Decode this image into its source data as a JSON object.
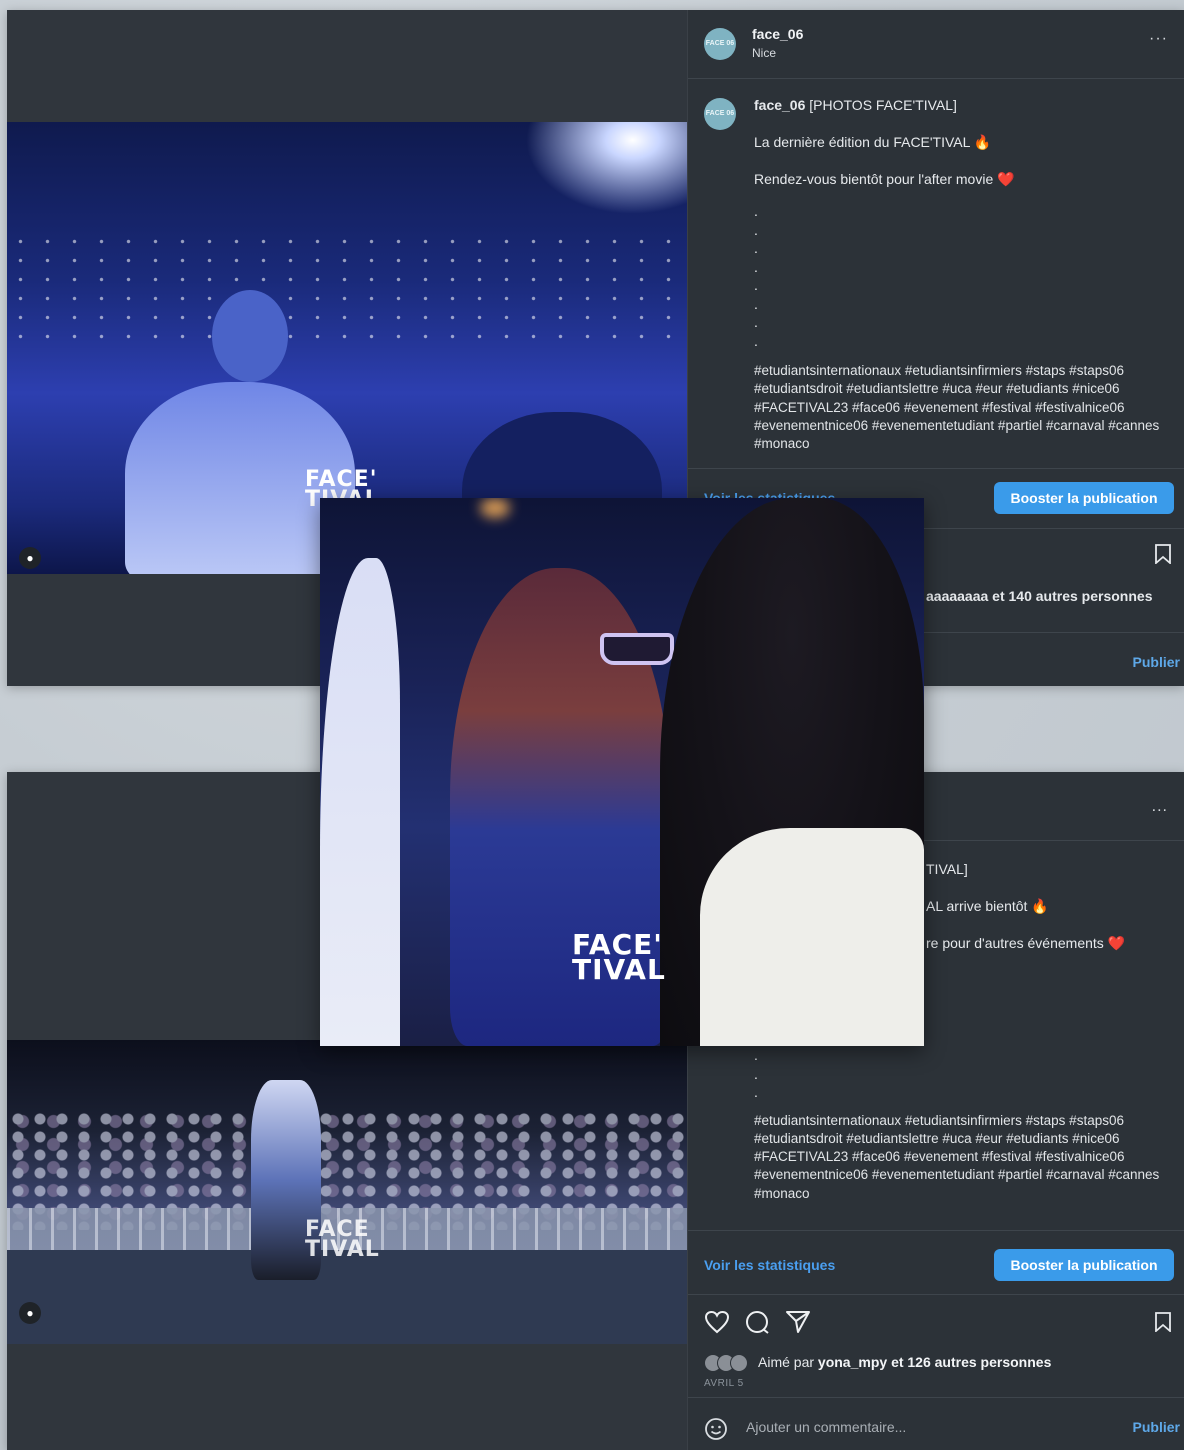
{
  "accent": "#3a9bea",
  "post1": {
    "account": {
      "avatar_text": "FACE 06",
      "username": "face_06",
      "location": "Nice"
    },
    "caption": {
      "username": "face_06",
      "title": "[PHOTOS FACE'TIVAL]",
      "line1": "La dernière édition du FACE'TIVAL 🔥",
      "line2": "Rendez-vous bientôt pour l'after movie ❤️",
      "bullets": [
        ".",
        ".",
        ".",
        ".",
        ".",
        ".",
        ".",
        "."
      ],
      "hashtags": "#etudiantsinternationaux #etudiantsinfirmiers #staps #staps06 #etudiantsdroit #etudiantslettre #uca #eur #etudiants #nice06 #FACETIVAL23 #face06 #evenement #festival #festivalnice06 #evenementnice06 #evenementetudiant #partiel #carnaval #cannes #monaco"
    },
    "stats_link": "Voir les statistiques",
    "boost_label": "Booster la publication",
    "likes_text": "aaaaaaaa et 140 autres personnes",
    "publish_label": "Publier",
    "photo_logo": [
      "FACE'",
      "TIVAL"
    ]
  },
  "post2": {
    "more": "...",
    "caption": {
      "title_fragment": "TIVAL]",
      "line1_fragment": "AL arrive bientôt 🔥",
      "line2_fragment": "re pour d'autres événements ❤️",
      "bullets": [
        ".",
        ".",
        "."
      ],
      "hashtags": "#etudiantsinternationaux #etudiantsinfirmiers #staps #staps06 #etudiantsdroit #etudiantslettre #uca #eur #etudiants #nice06 #FACETIVAL23 #face06 #evenement #festival #festivalnice06 #evenementnice06 #evenementetudiant #partiel #carnaval #cannes #monaco"
    },
    "stats_link": "Voir les statistiques",
    "boost_label": "Booster la publication",
    "likes_prefix": "Aimé par",
    "likes_user": "yona_mpy",
    "likes_suffix": "et 126 autres personnes",
    "date": "AVRIL 5",
    "comment_placeholder": "Ajouter un commentaire...",
    "publish_label": "Publier",
    "photo_logo": [
      "FACE",
      "TIVAL"
    ]
  },
  "overlay": {
    "logo": [
      "FACE'",
      "TIVAL"
    ]
  }
}
